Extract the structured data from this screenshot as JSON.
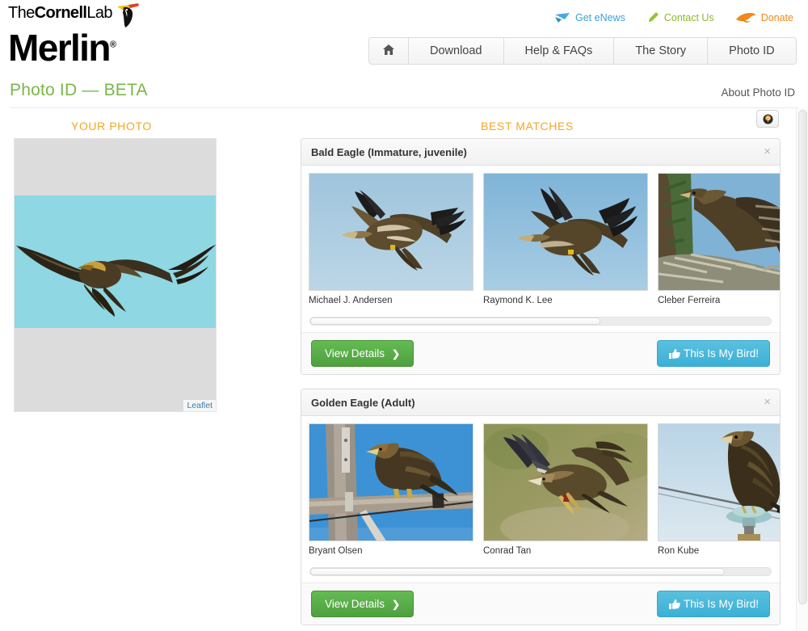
{
  "brand": {
    "cornell_the": "The",
    "cornell_bold": "Cornell",
    "cornell_lab": "Lab",
    "merlin": "Merlin",
    "registered": "®"
  },
  "utility_links": [
    {
      "label": "Get eNews",
      "icon": "envelope-icon",
      "color": "#3aa3d6"
    },
    {
      "label": "Contact Us",
      "icon": "pencil-icon",
      "color": "#8cb82b"
    },
    {
      "label": "Donate",
      "icon": "bird-icon",
      "color": "#f08a1c"
    }
  ],
  "nav": {
    "home_icon": "home-icon",
    "items": [
      {
        "label": "Download"
      },
      {
        "label": "Help & FAQs"
      },
      {
        "label": "The Story"
      },
      {
        "label": "Photo ID"
      }
    ]
  },
  "header": {
    "page_title": "Photo ID — BETA",
    "about_link": "About Photo ID",
    "title_color": "#7ab648"
  },
  "columns": {
    "your_photo": "YOUR PHOTO",
    "best_matches": "BEST MATCHES",
    "heading_color": "#f5a623"
  },
  "help_button": {
    "icon": "question-circle-icon"
  },
  "your_photo": {
    "attribution": "Leaflet",
    "sky_color": "#8ed7e3",
    "backdrop_color": "#dcdcdc"
  },
  "results": [
    {
      "title": "Bald Eagle (Immature, juvenile)",
      "close_label": "×",
      "photos": [
        {
          "credit": "Michael J. Andersen",
          "scene": "eagle-in-flight-blue-sky"
        },
        {
          "credit": "Raymond K. Lee",
          "scene": "eagle-in-flight-blue-sky"
        },
        {
          "credit": "Cleber Ferreira",
          "scene": "juvenile-eagle-in-nest"
        }
      ],
      "scroll_position": 0,
      "scroll_thumb_percent": 63,
      "view_details_label": "View Details",
      "view_details_chevron": "❯",
      "my_bird_label": "This Is My Bird!",
      "my_bird_icon": "thumbs-up-icon"
    },
    {
      "title": "Golden Eagle (Adult)",
      "close_label": "×",
      "photos": [
        {
          "credit": "Bryant Olsen",
          "scene": "golden-eagle-on-utility-pole"
        },
        {
          "credit": "Conrad Tan",
          "scene": "golden-eagle-flying-over-grass"
        },
        {
          "credit": "Ron Kube",
          "scene": "golden-eagle-on-power-line"
        }
      ],
      "scroll_position": 0,
      "scroll_thumb_percent": 90,
      "view_details_label": "View Details",
      "view_details_chevron": "❯",
      "my_bird_label": "This Is My Bird!",
      "my_bird_icon": "thumbs-up-icon"
    }
  ],
  "colors": {
    "green_button": "#4fa03f",
    "blue_button": "#3bb0d6",
    "orange": "#f5a623",
    "brand_green": "#7ab648"
  }
}
